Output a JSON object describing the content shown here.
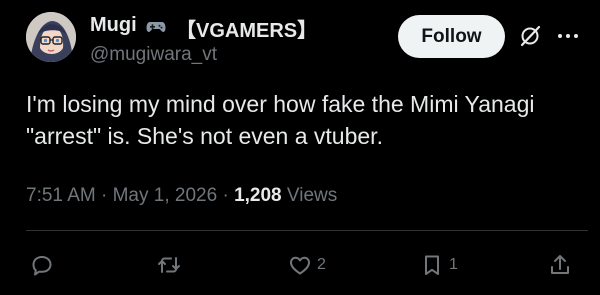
{
  "author": {
    "display_name": "Mugi",
    "affiliation": "【VGAMERS】",
    "handle": "@mugiwara_vt"
  },
  "follow_label": "Follow",
  "tweet": {
    "line1": "I'm losing my mind over how fake the Mimi Yanagi",
    "line2": "\"arrest\" is. She's not even a vtuber."
  },
  "meta": {
    "time": "7:51 AM",
    "sep1": " · ",
    "date": "May 1, 2026",
    "sep2": " · ",
    "views_count": "1,208",
    "views_label": " Views"
  },
  "actions": {
    "likes": "2",
    "bookmarks": "1"
  },
  "icons": [
    "avatar",
    "gamepad-icon",
    "grok-icon",
    "more-icon",
    "reply-icon",
    "repost-icon",
    "like-icon",
    "bookmark-icon",
    "share-icon"
  ],
  "colors": {
    "background": "#000000",
    "text": "#e7e9ea",
    "muted": "#71767b",
    "follow_bg": "#eff3f4"
  }
}
